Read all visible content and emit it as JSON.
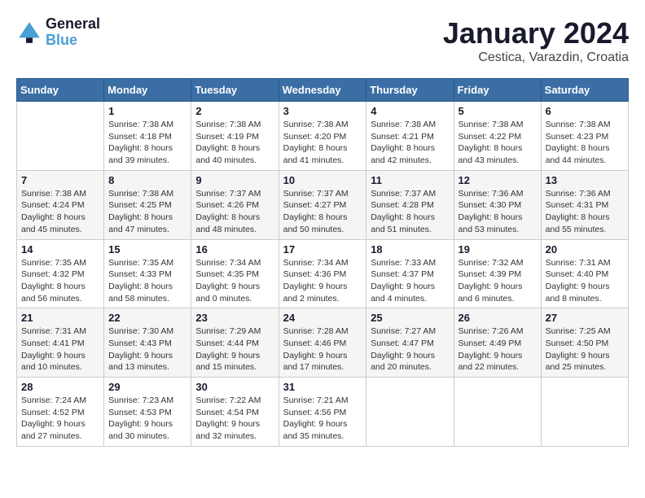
{
  "header": {
    "logo_line1": "General",
    "logo_line2": "Blue",
    "title": "January 2024",
    "subtitle": "Cestica, Varazdin, Croatia"
  },
  "weekdays": [
    "Sunday",
    "Monday",
    "Tuesday",
    "Wednesday",
    "Thursday",
    "Friday",
    "Saturday"
  ],
  "weeks": [
    [
      {
        "day": "",
        "info": ""
      },
      {
        "day": "1",
        "info": "Sunrise: 7:38 AM\nSunset: 4:18 PM\nDaylight: 8 hours\nand 39 minutes."
      },
      {
        "day": "2",
        "info": "Sunrise: 7:38 AM\nSunset: 4:19 PM\nDaylight: 8 hours\nand 40 minutes."
      },
      {
        "day": "3",
        "info": "Sunrise: 7:38 AM\nSunset: 4:20 PM\nDaylight: 8 hours\nand 41 minutes."
      },
      {
        "day": "4",
        "info": "Sunrise: 7:38 AM\nSunset: 4:21 PM\nDaylight: 8 hours\nand 42 minutes."
      },
      {
        "day": "5",
        "info": "Sunrise: 7:38 AM\nSunset: 4:22 PM\nDaylight: 8 hours\nand 43 minutes."
      },
      {
        "day": "6",
        "info": "Sunrise: 7:38 AM\nSunset: 4:23 PM\nDaylight: 8 hours\nand 44 minutes."
      }
    ],
    [
      {
        "day": "7",
        "info": "Sunrise: 7:38 AM\nSunset: 4:24 PM\nDaylight: 8 hours\nand 45 minutes."
      },
      {
        "day": "8",
        "info": "Sunrise: 7:38 AM\nSunset: 4:25 PM\nDaylight: 8 hours\nand 47 minutes."
      },
      {
        "day": "9",
        "info": "Sunrise: 7:37 AM\nSunset: 4:26 PM\nDaylight: 8 hours\nand 48 minutes."
      },
      {
        "day": "10",
        "info": "Sunrise: 7:37 AM\nSunset: 4:27 PM\nDaylight: 8 hours\nand 50 minutes."
      },
      {
        "day": "11",
        "info": "Sunrise: 7:37 AM\nSunset: 4:28 PM\nDaylight: 8 hours\nand 51 minutes."
      },
      {
        "day": "12",
        "info": "Sunrise: 7:36 AM\nSunset: 4:30 PM\nDaylight: 8 hours\nand 53 minutes."
      },
      {
        "day": "13",
        "info": "Sunrise: 7:36 AM\nSunset: 4:31 PM\nDaylight: 8 hours\nand 55 minutes."
      }
    ],
    [
      {
        "day": "14",
        "info": "Sunrise: 7:35 AM\nSunset: 4:32 PM\nDaylight: 8 hours\nand 56 minutes."
      },
      {
        "day": "15",
        "info": "Sunrise: 7:35 AM\nSunset: 4:33 PM\nDaylight: 8 hours\nand 58 minutes."
      },
      {
        "day": "16",
        "info": "Sunrise: 7:34 AM\nSunset: 4:35 PM\nDaylight: 9 hours\nand 0 minutes."
      },
      {
        "day": "17",
        "info": "Sunrise: 7:34 AM\nSunset: 4:36 PM\nDaylight: 9 hours\nand 2 minutes."
      },
      {
        "day": "18",
        "info": "Sunrise: 7:33 AM\nSunset: 4:37 PM\nDaylight: 9 hours\nand 4 minutes."
      },
      {
        "day": "19",
        "info": "Sunrise: 7:32 AM\nSunset: 4:39 PM\nDaylight: 9 hours\nand 6 minutes."
      },
      {
        "day": "20",
        "info": "Sunrise: 7:31 AM\nSunset: 4:40 PM\nDaylight: 9 hours\nand 8 minutes."
      }
    ],
    [
      {
        "day": "21",
        "info": "Sunrise: 7:31 AM\nSunset: 4:41 PM\nDaylight: 9 hours\nand 10 minutes."
      },
      {
        "day": "22",
        "info": "Sunrise: 7:30 AM\nSunset: 4:43 PM\nDaylight: 9 hours\nand 13 minutes."
      },
      {
        "day": "23",
        "info": "Sunrise: 7:29 AM\nSunset: 4:44 PM\nDaylight: 9 hours\nand 15 minutes."
      },
      {
        "day": "24",
        "info": "Sunrise: 7:28 AM\nSunset: 4:46 PM\nDaylight: 9 hours\nand 17 minutes."
      },
      {
        "day": "25",
        "info": "Sunrise: 7:27 AM\nSunset: 4:47 PM\nDaylight: 9 hours\nand 20 minutes."
      },
      {
        "day": "26",
        "info": "Sunrise: 7:26 AM\nSunset: 4:49 PM\nDaylight: 9 hours\nand 22 minutes."
      },
      {
        "day": "27",
        "info": "Sunrise: 7:25 AM\nSunset: 4:50 PM\nDaylight: 9 hours\nand 25 minutes."
      }
    ],
    [
      {
        "day": "28",
        "info": "Sunrise: 7:24 AM\nSunset: 4:52 PM\nDaylight: 9 hours\nand 27 minutes."
      },
      {
        "day": "29",
        "info": "Sunrise: 7:23 AM\nSunset: 4:53 PM\nDaylight: 9 hours\nand 30 minutes."
      },
      {
        "day": "30",
        "info": "Sunrise: 7:22 AM\nSunset: 4:54 PM\nDaylight: 9 hours\nand 32 minutes."
      },
      {
        "day": "31",
        "info": "Sunrise: 7:21 AM\nSunset: 4:56 PM\nDaylight: 9 hours\nand 35 minutes."
      },
      {
        "day": "",
        "info": ""
      },
      {
        "day": "",
        "info": ""
      },
      {
        "day": "",
        "info": ""
      }
    ]
  ]
}
